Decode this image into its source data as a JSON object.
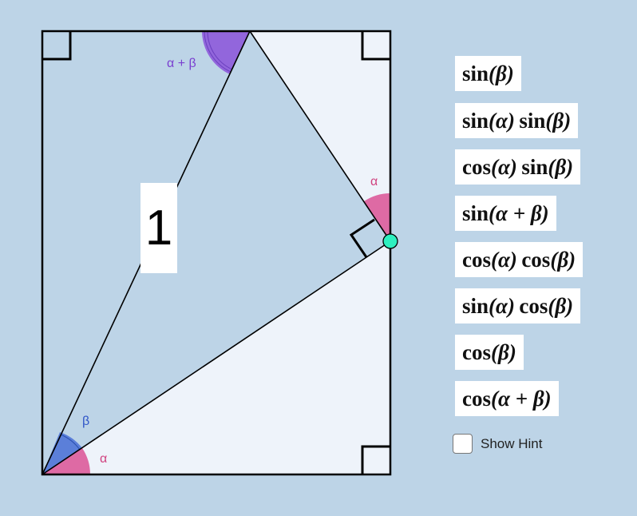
{
  "diagram": {
    "side_label": "1",
    "angle_labels": {
      "top": "α + β",
      "right": "α",
      "bottom_beta": "β",
      "bottom_alpha": "α"
    },
    "colors": {
      "background": "#bdd4e7",
      "light_region": "#eef3fa",
      "alpha": "#de6aa4",
      "beta": "#5b7fd9",
      "alpha_plus_beta": "#9266dc",
      "point": "#2ef0c0"
    }
  },
  "expressions": [
    {
      "fn": "sin",
      "arg": "(β)"
    },
    {
      "fn": "sin",
      "arg": "(α)",
      "fn2": "sin",
      "arg2": "(β)"
    },
    {
      "fn": "cos",
      "arg": "(α)",
      "fn2": "sin",
      "arg2": "(β)"
    },
    {
      "fn": "sin",
      "arg": "(α  +  β)"
    },
    {
      "fn": "cos",
      "arg": "(α)",
      "fn2": "cos",
      "arg2": "(β)"
    },
    {
      "fn": "sin",
      "arg": "(α)",
      "fn2": "cos",
      "arg2": "(β)"
    },
    {
      "fn": "cos",
      "arg": "(β)"
    },
    {
      "fn": "cos",
      "arg": "(α  +  β)"
    }
  ],
  "hint": {
    "label": "Show Hint",
    "checked": false
  }
}
